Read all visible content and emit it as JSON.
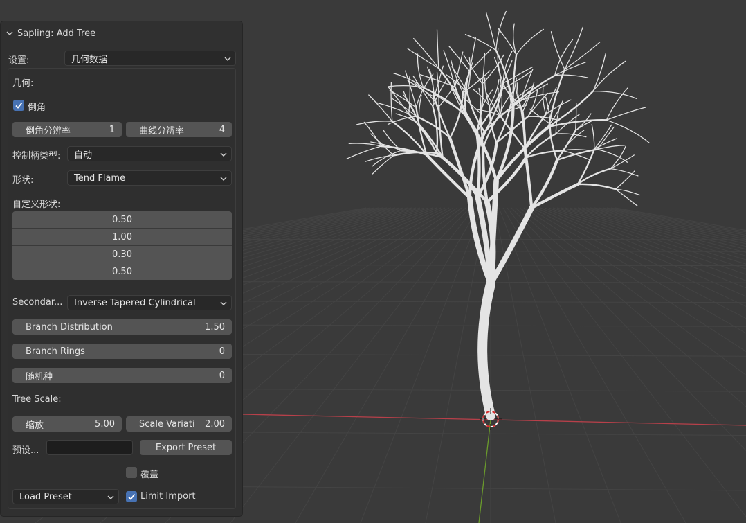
{
  "panel": {
    "title": "Sapling: Add Tree",
    "settings_label": "设置:",
    "settings_value": "几何数据",
    "geometry_label": "几何:",
    "bevel_label": "倒角",
    "bevel_checked": true,
    "bevel_resolution": {
      "label": "倒角分辨率",
      "value": "1"
    },
    "curve_resolution": {
      "label": "曲线分辨率",
      "value": "4"
    },
    "handle_type_label": "控制柄类型:",
    "handle_type_value": "自动",
    "shape_label": "形状:",
    "shape_value": "Tend Flame",
    "custom_shape_label": "自定义形状:",
    "custom_shape_values": [
      "0.50",
      "1.00",
      "0.30",
      "0.50"
    ],
    "secondary_label": "Secondar...",
    "secondary_value": "Inverse Tapered Cylindrical",
    "branch_distribution": {
      "label": "Branch Distribution",
      "value": "1.50"
    },
    "branch_rings": {
      "label": "Branch Rings",
      "value": "0"
    },
    "random_seed": {
      "label": "随机种",
      "value": "0"
    },
    "tree_scale_label": "Tree Scale:",
    "scale": {
      "label": "缩放",
      "value": "5.00"
    },
    "scale_variation": {
      "label": "Scale Variati",
      "value": "2.00"
    },
    "preset_label": "预设...",
    "preset_name_value": "",
    "export_preset_label": "Export Preset",
    "overwrite_label": "覆盖",
    "overwrite_checked": false,
    "load_preset_label": "Load Preset",
    "limit_import_label": "Limit Import",
    "limit_import_checked": true
  },
  "colors": {
    "background": "#3a3a3a",
    "panel": "#303030",
    "field": "#545454",
    "accent": "#4772b3",
    "x_axis": "#b8404a",
    "y_axis": "#6a9a2c",
    "tree": "#e4e4e4"
  }
}
